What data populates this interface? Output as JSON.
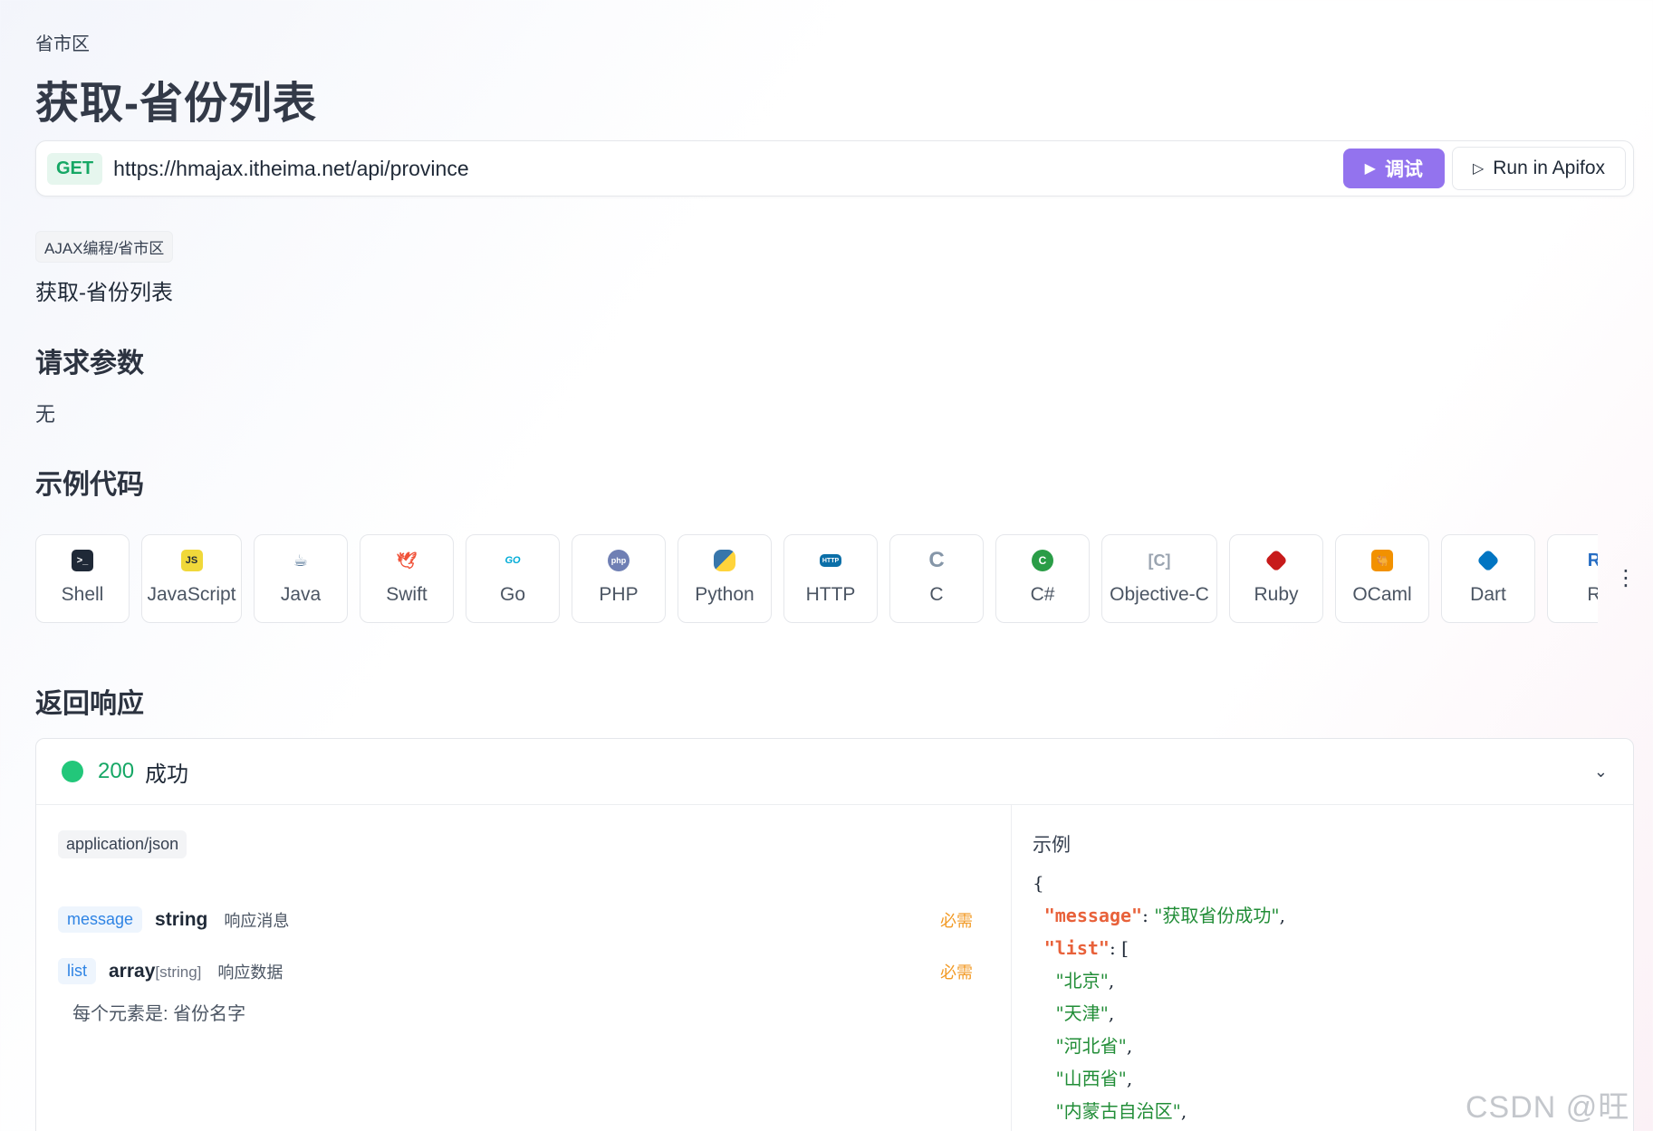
{
  "breadcrumb": "省市区",
  "page_title": "获取-省份列表",
  "request": {
    "method": "GET",
    "url": "https://hmajax.itheima.net/api/province",
    "debug_label": "调试",
    "run_label": "Run in Apifox"
  },
  "tag": "AJAX编程/省市区",
  "description": "获取-省份列表",
  "params": {
    "title": "请求参数",
    "none": "无"
  },
  "code_samples": {
    "title": "示例代码",
    "languages": [
      {
        "label": "Shell",
        "icon": "terminal-icon"
      },
      {
        "label": "JavaScript",
        "icon": "js-icon"
      },
      {
        "label": "Java",
        "icon": "java-icon"
      },
      {
        "label": "Swift",
        "icon": "swift-icon"
      },
      {
        "label": "Go",
        "icon": "go-icon"
      },
      {
        "label": "PHP",
        "icon": "php-icon"
      },
      {
        "label": "Python",
        "icon": "python-icon"
      },
      {
        "label": "HTTP",
        "icon": "http-icon"
      },
      {
        "label": "C",
        "icon": "c-icon"
      },
      {
        "label": "C#",
        "icon": "csharp-icon"
      },
      {
        "label": "Objective-C",
        "icon": "objc-icon"
      },
      {
        "label": "Ruby",
        "icon": "ruby-icon"
      },
      {
        "label": "OCaml",
        "icon": "ocaml-icon"
      },
      {
        "label": "Dart",
        "icon": "dart-icon"
      },
      {
        "label": "R",
        "icon": "r-icon"
      }
    ]
  },
  "response": {
    "title": "返回响应",
    "status_code": "200",
    "status_text": "成功",
    "content_type": "application/json",
    "fields": [
      {
        "name": "message",
        "type": "string",
        "type_sub": "",
        "desc": "响应消息",
        "required": "必需"
      },
      {
        "name": "list",
        "type": "array",
        "type_sub": "[string]",
        "desc": "响应数据",
        "required": "必需"
      }
    ],
    "list_note": "每个元素是: 省份名字",
    "example_label": "示例",
    "example": {
      "message_key": "\"message\"",
      "message_value": "\"获取省份成功\"",
      "list_key": "\"list\"",
      "list_items": [
        "\"北京\"",
        "\"天津\"",
        "\"河北省\"",
        "\"山西省\"",
        "\"内蒙古自治区\""
      ]
    }
  },
  "watermark": "CSDN @旺代",
  "colors": {
    "accent": "#9373ee",
    "success": "#16a765",
    "link": "#2f84e4",
    "required": "#f29a25"
  }
}
